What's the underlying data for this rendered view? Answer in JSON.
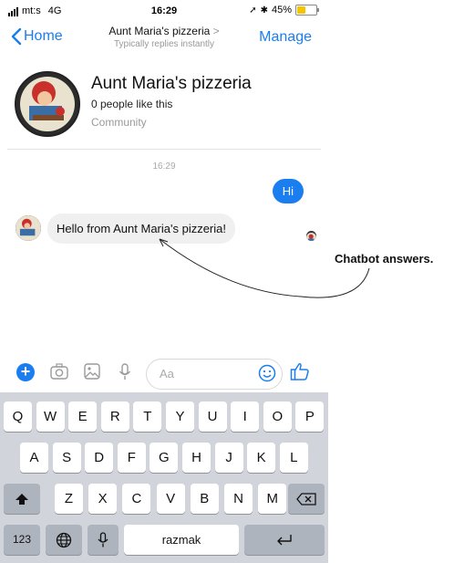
{
  "status_bar": {
    "carrier": "mt:s",
    "network": "4G",
    "time": "16:29",
    "battery": "45%",
    "battery_level": 0.45
  },
  "nav": {
    "back_label": "Home",
    "title": "Aunt Maria's pizzeria",
    "title_chevron": ">",
    "subtitle": "Typically replies instantly",
    "manage_label": "Manage"
  },
  "page": {
    "name": "Aunt Maria's pizzeria",
    "likes": "0 people like this",
    "category": "Community"
  },
  "chat": {
    "timestamp": "16:29",
    "outgoing": "Hi",
    "incoming": "Hello from Aunt Maria's pizzeria!"
  },
  "composer": {
    "placeholder": "Aa"
  },
  "keyboard": {
    "row1": [
      "Q",
      "W",
      "E",
      "R",
      "T",
      "Y",
      "U",
      "I",
      "O",
      "P"
    ],
    "row2": [
      "A",
      "S",
      "D",
      "F",
      "G",
      "H",
      "J",
      "K",
      "L"
    ],
    "row3": [
      "Z",
      "X",
      "C",
      "V",
      "B",
      "N",
      "M"
    ],
    "numbers_key": "123",
    "space_label": "razmak"
  },
  "annotation": {
    "label": "Chatbot answers."
  },
  "colors": {
    "accent": "#1a7ef0",
    "keyboard_bg": "#d1d5db",
    "incoming_bubble": "#f0f0f0"
  }
}
